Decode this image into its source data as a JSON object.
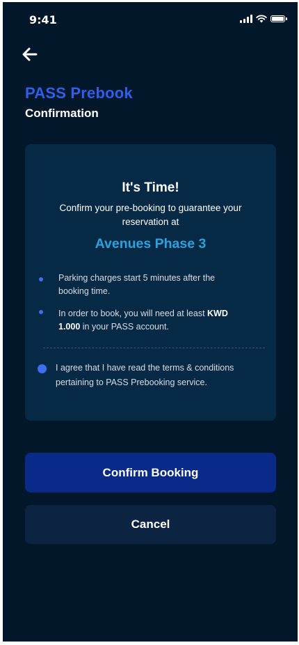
{
  "status_bar": {
    "time": "9:41",
    "icons": [
      "signal-icon",
      "wifi-icon",
      "battery-icon"
    ]
  },
  "header": {
    "back_icon": "arrow-left-icon",
    "title": "PASS Prebook",
    "subtitle": "Confirmation"
  },
  "card": {
    "heading": "It's Time!",
    "description": "Confirm your pre-booking to guarantee your reservation at",
    "location": "Avenues Phase 3",
    "bullets": [
      {
        "text": "Parking charges start 5 minutes after the booking time."
      },
      {
        "text_before": "In order to book, you will need at least ",
        "amount": "KWD 1.000",
        "text_after": " in your PASS account."
      }
    ],
    "agreement": {
      "checked": true,
      "text": "I agree that I have read the terms & conditions pertaining to PASS Prebooking service."
    }
  },
  "actions": {
    "confirm_label": "Confirm Booking",
    "cancel_label": "Cancel"
  },
  "colors": {
    "background": "#02182a",
    "card": "#062a46",
    "title_accent": "#2f5fe8",
    "location_accent": "#2aa2de",
    "bullet": "#3d6ef0",
    "confirm_button": "#0a2a8a",
    "cancel_button": "#0c2442"
  }
}
